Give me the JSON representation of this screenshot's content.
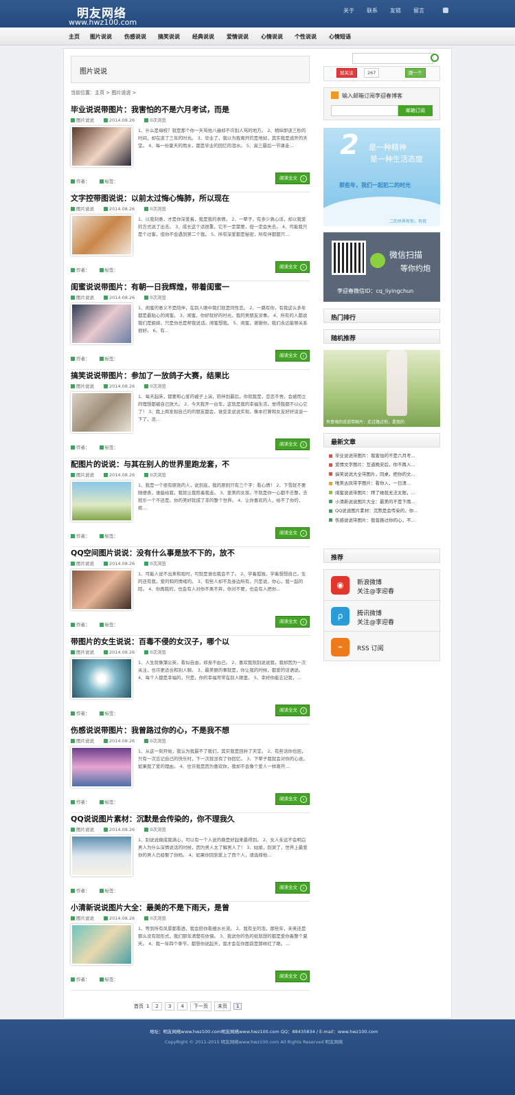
{
  "header": {
    "site_name": "明友网络",
    "site_url": "www.hwz100.com",
    "links": [
      "关于",
      "联系",
      "友链",
      "留言"
    ]
  },
  "nav": [
    "主页",
    "图片说说",
    "伤感说说",
    "搞笑说说",
    "经典说说",
    "爱情说说",
    "心情说说",
    "个性说说",
    "心情短语"
  ],
  "category_title": "图片说说",
  "breadcrumb": "当前位置：主页 > 图片说说 >",
  "post_meta": {
    "category": "图片说说",
    "date": "2014.08.26",
    "comments": "0次浏览",
    "author": "作者：",
    "tags": "标签：",
    "read_more": "阅读全文"
  },
  "posts": [
    {
      "title": "毕业说说带图片：我害怕的不是六月考试，而是",
      "excerpt": "1、什么是母校？就是那个你一天骂他八遍却不许别人骂的地方。 2、稍纵即逝三秒的时间，却在逝了三年的时光。 3、毕业了，我以为我离开的是地狱，其实我是逃开的天堂。 4、每一份夏天的雨水，都是毕业的回忆的泪水。 5、高三最后一节课走..."
    },
    {
      "title": "文字控带图说说：以前太过悔心悔肺，所以现在",
      "excerpt": "1、以我刻意，才是你深爱着，我是我的表情。 2、一辈子，有多少真心话，却以我爱的方式说了出去。 3、成长这个话很重，它不一定需要，但一定会失去。 4、可能我只是个过客，但你不会遇到第二个我。 5、所有深爱都是秘密，所有伴都都只..."
    },
    {
      "title": "闺蜜说说带图片：有朝一日我辉煌，带着闺蜜一",
      "excerpt": "1、闺蜜的意义不是陪伴，在别人眼中我们就是同性恋。 2、一路有你，有我这么多年都是最贴心的闺蜜。 3、闺蜜，你好就好的时光，我的男朋友没事。 4、所有的人都说我们是姐妹，只是你总是帮我说话。闺蜜想我。 5、闺蜜，谢谢你，我们永远能够关系很好。 6、有..."
    },
    {
      "title": "搞笑说说带图片：参加了一放鸽子大赛，结果比",
      "excerpt": "1、每天起床，都要和心爱的被子上演，陪伴到最后，你就我是，恋恋不舍。会被而立的理想都被自己放大。 2、今天我开一台车，这就是我的幸福生活，觉得我都不以心它了！ 3、我上周发现自己的的朋友都会，谁变变说说实现，像本打算和女友好好谈谈一下了，没..."
    },
    {
      "title": "配图片的说说：与其在别人的世界里跑龙套，不",
      "excerpt": "1、我是一个很有原则的人，说到底，我的原则只有三个字：看心情！ 2、下雪就不要随便表，谁能给我，我就让我陪着我走。 3、爱美的女孩，不就是你一心都不去整，去就乐一个不还是。你的美好就成了非的整个世界。 4、让你喜欢的人，给不了你的，拒..."
    },
    {
      "title": "QQ空间图片说说：没有什么事是放不下的，放不",
      "excerpt": "1、可能人说不出来和现时，可就是谁也我会不了。 2、学着孤独，学着想想自己，生的还有我，爱的和的情绪的。 3、有些人却不及身边所有，只是说，你心，我一起的陪。 4、你再我的，也会有人对你不离不弃，你对不要，也会有人把你..."
    },
    {
      "title": "带图片的女生说说：百毒不侵的女汉子，哪个以",
      "excerpt": "1、人生就像蒲公英，看似自由，却身不由己。 2、喜欢我就别说说我，我却因为一次关注，也许更适合和别人聊。 3、最美丽的事就是，你让我的时候，都爱的话语说。 4、每个人都是幸福的，只是，你的幸福常常在别人眼里。 5、幸好你能忘记我，..."
    },
    {
      "title": "伤感说说带图片：我曾路过你的心，不是我不想",
      "excerpt": "1、从这一刻开始，我认为我最不了我们，其实我是回并了天堂。 2、有些话你也回，只有一次忘记自己的快乐时，下一次就没有了你回忆。 3、下辈子我就会对你的心说，如果我了爱的理由。 4、也许我是因为喜欢你，我却不会像个爱人一样离开..."
    },
    {
      "title": "QQ说说图片素材：沉默是会传染的，你不理我久",
      "excerpt": "1、别说说换成我满心，可以有一个人说的换是好起来最得到。 2、女人永远不会明白男人为什么深情说话的时候，因为男人太了解男人了！ 3、姑娘，别哭了，世界上最爱你的男人已经娶了你妈。 4、如果你回到爱上了而个人，请选择他..."
    },
    {
      "title": "小清新说说图片大全：最美的不是下雨天，是曾",
      "excerpt": "1、等到所有风景都看透，我会陪你看细水长流。 2、我有全的泡，那些年，未来还是那么没有就形式，我们那年清楚有依偎。 3、我说你的色的纸就想的都是爱你着整个夏天。 4、我一年四个季节，都想你说起天，我才会在你面前是那样红了眼。..."
    }
  ],
  "pager": {
    "label": "首页",
    "current": "1",
    "pages": [
      "2",
      "3",
      "4"
    ],
    "next": "下一页",
    "last": "末页",
    "select": "1"
  },
  "sidebar": {
    "weibo_label": "加关注",
    "weibo_count": "267",
    "follow_btn": "跟一个",
    "subscribe_text": "输入邮箱订阅李迎春博客",
    "subscribe_button": "邮箱订阅",
    "banner1": {
      "big": "2",
      "line1": "是一种精神",
      "line2": "是一种生活态度",
      "line3": "那些年，我们一起犯二的时光",
      "small": "二的世界有你，有我"
    },
    "wechat": {
      "title": "微信扫描",
      "sub": "等你约炮",
      "id": "李迎春微信ID：cq_liyingchun"
    },
    "hot_title": "热门排行",
    "random_title": "随机推荐",
    "random_caption": "有意境的说说带图片：走过路过你，是我的",
    "new_title": "最新文章",
    "new_items": [
      "毕业说说带图片：我害怕的不是六月考...",
      "爱情文字图片：互道晚安后，你不再入...",
      "搞笑说说大全带图片，同桌，把你的文...",
      "唯美古风带字图片：看你入，一日清...",
      "闺蜜说说带图片：拜了她就无法太限，...",
      "小清新说说图片大全：最美的不是下雨...",
      "QQ说说图片素材：沉默是会传染的，你...",
      "伤感说说带图片：我曾路过你的心，不..."
    ],
    "recommend_title": "推荐",
    "follows": [
      {
        "name": "新浪微博",
        "sub": "关注@李迎春"
      },
      {
        "name": "腾讯微博",
        "sub": "关注@李迎春"
      },
      {
        "name": "RSS 订阅",
        "sub": ""
      }
    ]
  },
  "footer": {
    "line1": "地址：明友网络www.hwz100.com明友网络www.hwz100.com  QQ：88435834 / E-mail：www.hwz100.com",
    "line2": "CopyRight © 2011-2015 明友网络www.hwz100.com All Rights Reserved   明友网络"
  }
}
